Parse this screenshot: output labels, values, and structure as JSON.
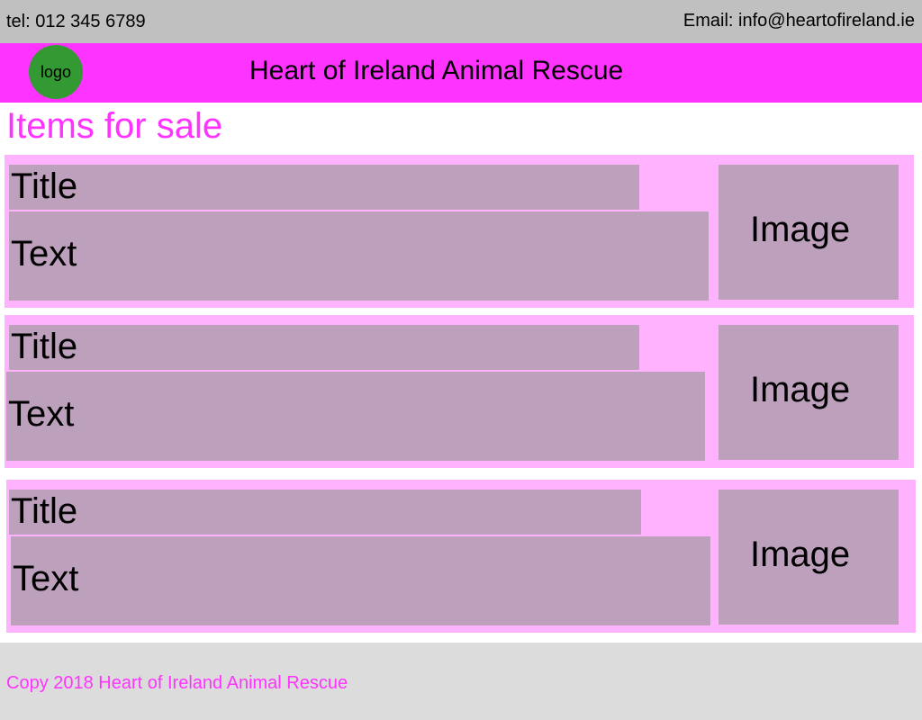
{
  "contact": {
    "tel": "tel: 012 345 6789",
    "email": "Email: info@heartofireland.ie"
  },
  "header": {
    "logo_label": "logo",
    "site_title": "Heart of Ireland Animal Rescue"
  },
  "main": {
    "page_title": "Items for sale",
    "items": [
      {
        "title": "Title",
        "text": "Text",
        "image_label": "Image"
      },
      {
        "title": "Title",
        "text": "Text",
        "image_label": "Image"
      },
      {
        "title": "Title",
        "text": "Text",
        "image_label": "Image"
      }
    ]
  },
  "footer": {
    "copyright": "Copy 2018 Heart of Ireland Animal Rescue"
  },
  "colors": {
    "accent_magenta": "#ff33ff",
    "card_pink": "#ffb3ff",
    "placeholder_mauve": "#bca0bc",
    "logo_green": "#339933",
    "topbar_gray": "#c0c0c0",
    "footer_gray": "#dcdcdc"
  }
}
